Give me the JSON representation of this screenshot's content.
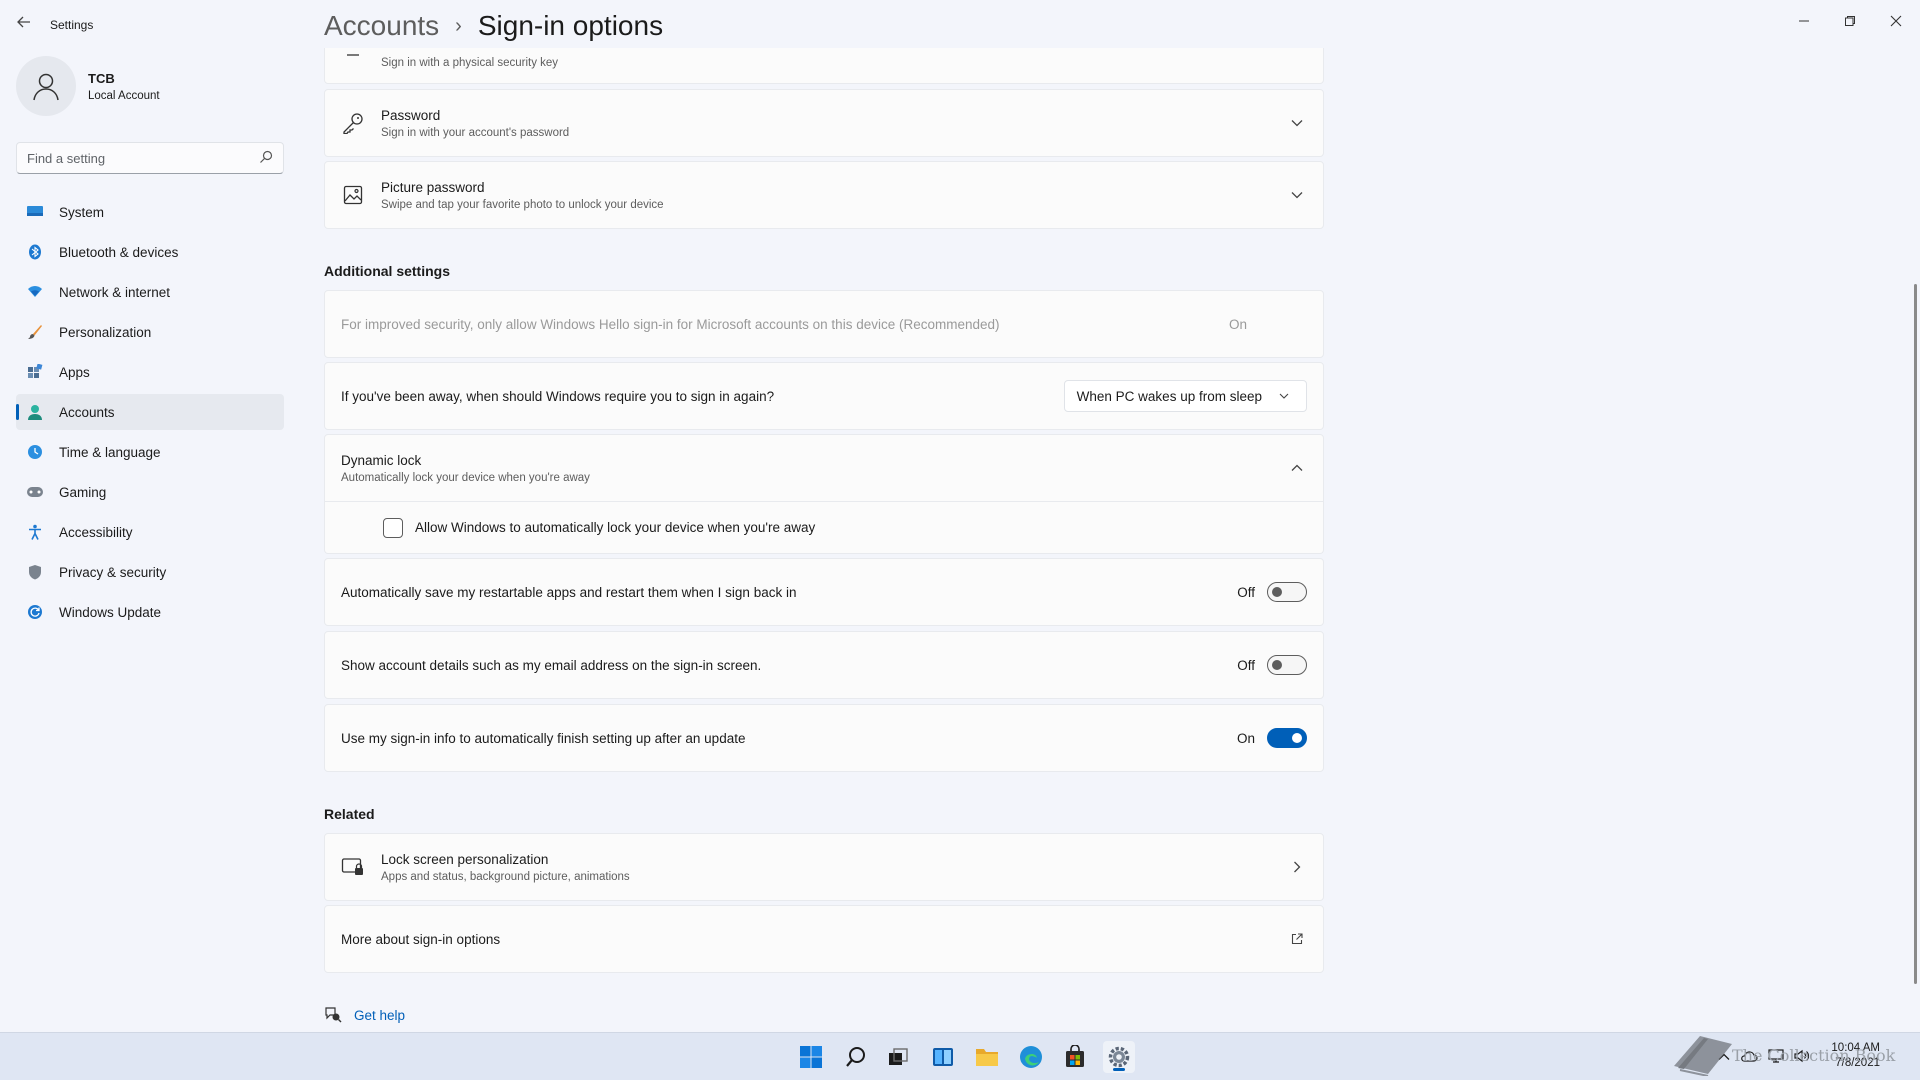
{
  "app": {
    "title": "Settings"
  },
  "profile": {
    "name": "TCB",
    "account_type": "Local Account"
  },
  "search": {
    "placeholder": "Find a setting"
  },
  "nav": {
    "items": [
      {
        "label": "System",
        "icon": "system-icon"
      },
      {
        "label": "Bluetooth & devices",
        "icon": "bluetooth-icon"
      },
      {
        "label": "Network & internet",
        "icon": "wifi-icon"
      },
      {
        "label": "Personalization",
        "icon": "brush-icon"
      },
      {
        "label": "Apps",
        "icon": "apps-icon"
      },
      {
        "label": "Accounts",
        "icon": "accounts-icon",
        "active": true
      },
      {
        "label": "Time & language",
        "icon": "clock-globe-icon"
      },
      {
        "label": "Gaming",
        "icon": "gamepad-icon"
      },
      {
        "label": "Accessibility",
        "icon": "accessibility-icon"
      },
      {
        "label": "Privacy & security",
        "icon": "shield-icon"
      },
      {
        "label": "Windows Update",
        "icon": "update-icon"
      }
    ]
  },
  "breadcrumb": {
    "parent": "Accounts",
    "separator": "›",
    "current": "Sign-in options"
  },
  "sign_in_methods": {
    "security_key": {
      "subtitle": "Sign in with a physical security key"
    },
    "password": {
      "title": "Password",
      "subtitle": "Sign in with your account's password"
    },
    "picture_password": {
      "title": "Picture password",
      "subtitle": "Swipe and tap your favorite photo to unlock your device"
    }
  },
  "additional": {
    "heading": "Additional settings",
    "hello_only": {
      "label": "For improved security, only allow Windows Hello sign-in for Microsoft accounts on this device (Recommended)",
      "state": "On"
    },
    "require_signin": {
      "label": "If you've been away, when should Windows require you to sign in again?",
      "selected": "When PC wakes up from sleep"
    },
    "dynamic_lock": {
      "title": "Dynamic lock",
      "subtitle": "Automatically lock your device when you're away",
      "checkbox_label": "Allow Windows to automatically lock your device when you're away",
      "checked": false
    },
    "restart_apps": {
      "label": "Automatically save my restartable apps and restart them when I sign back in",
      "state": "Off"
    },
    "account_details": {
      "label": "Show account details such as my email address on the sign-in screen.",
      "state": "Off"
    },
    "finish_setup": {
      "label": "Use my sign-in info to automatically finish setting up after an update",
      "state": "On"
    }
  },
  "related": {
    "heading": "Related",
    "lock_screen": {
      "title": "Lock screen personalization",
      "subtitle": "Apps and status, background picture, animations"
    },
    "more_about": {
      "label": "More about sign-in options"
    }
  },
  "help": {
    "label": "Get help"
  },
  "taskbar": {
    "time": "10:04 AM",
    "date": "7/8/2021",
    "watermark": "The Collection Book"
  },
  "colors": {
    "accent": "#005fb8",
    "window_bg": "#f3f5fb",
    "card_bg": "#fbfbfb",
    "taskbar_bg": "#dfe6f3"
  }
}
